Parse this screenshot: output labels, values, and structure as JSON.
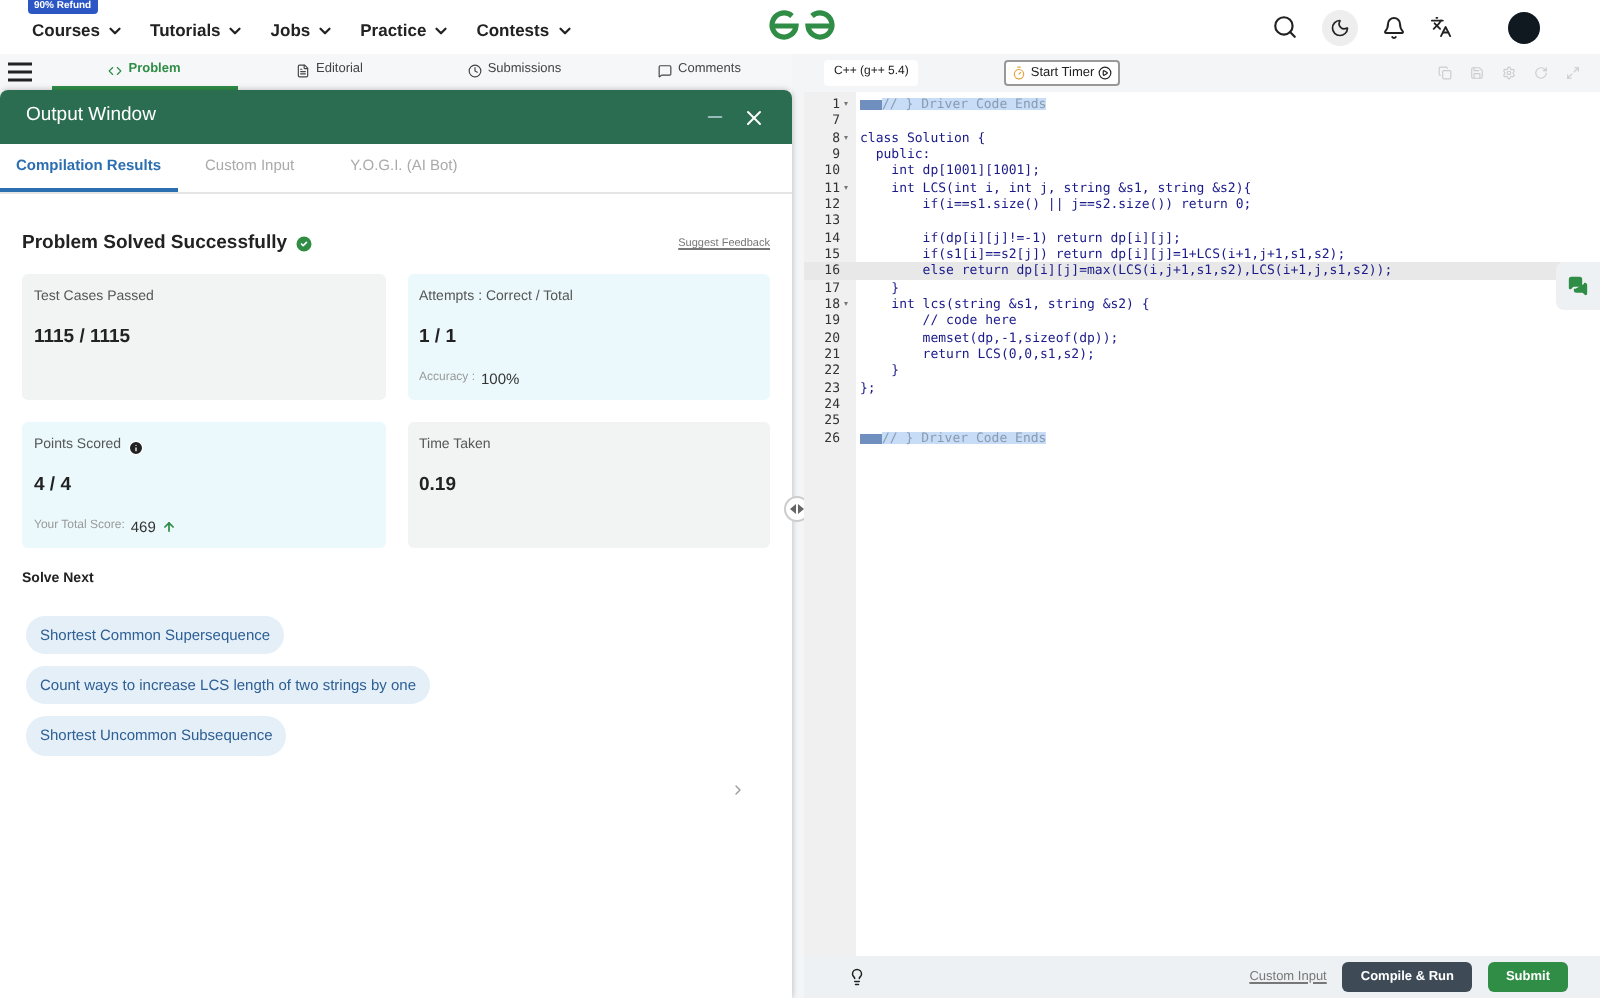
{
  "nav": {
    "badge": "90% Refund",
    "items": [
      "Courses",
      "Tutorials",
      "Jobs",
      "Practice",
      "Contests"
    ]
  },
  "problem_tabs": [
    {
      "label": "Problem",
      "selected": true
    },
    {
      "label": "Editorial",
      "selected": false
    },
    {
      "label": "Submissions",
      "selected": false
    },
    {
      "label": "Comments",
      "selected": false
    }
  ],
  "output_window": {
    "title": "Output Window",
    "tabs": [
      {
        "label": "Compilation Results",
        "selected": true
      },
      {
        "label": "Custom Input",
        "selected": false
      },
      {
        "label": "Y.O.G.I. (AI Bot)",
        "selected": false
      }
    ],
    "status": "Problem Solved Successfully",
    "feedback_link": "Suggest Feedback",
    "cards": [
      {
        "label": "Test Cases Passed",
        "value": "1115 / 1115",
        "info": false
      },
      {
        "label": "Attempts : Correct / Total",
        "value": "1 / 1",
        "info": false,
        "sub_label": "Accuracy :",
        "sub_value": "100%",
        "trend_up": false
      },
      {
        "label": "Points Scored",
        "value": "4 / 4",
        "info": true,
        "sub_label": "Your Total Score:",
        "sub_value": "469",
        "trend_up": true
      },
      {
        "label": "Time Taken",
        "value": "0.19",
        "info": false
      }
    ],
    "solve_next_title": "Solve Next",
    "solve_next": [
      "Shortest Common Supersequence",
      "Count ways to increase LCS length of two strings by one",
      "Shortest Uncommon Subsequence"
    ]
  },
  "editor": {
    "language": "C++ (g++ 5.4)",
    "timer_button": "Start Timer",
    "lines": [
      {
        "number": "1",
        "text": "// } Driver Code Ends",
        "highlighted": true,
        "foldable": true,
        "current": false
      },
      {
        "number": "7",
        "highlighted": false,
        "foldable": false,
        "current": false
      },
      {
        "number": "8",
        "text": "class Solution {",
        "highlighted": false,
        "foldable": true,
        "current": false
      },
      {
        "number": "9",
        "text": "  public:",
        "highlighted": false,
        "foldable": false,
        "current": false
      },
      {
        "number": "10",
        "text": "    int dp[1001][1001];",
        "highlighted": false,
        "foldable": false,
        "current": false
      },
      {
        "number": "11",
        "text": "    int LCS(int i, int j, string &s1, string &s2){",
        "highlighted": false,
        "foldable": true,
        "current": false
      },
      {
        "number": "12",
        "text": "        if(i==s1.size() || j==s2.size()) return 0;",
        "highlighted": false,
        "foldable": false,
        "current": false
      },
      {
        "number": "13",
        "highlighted": false,
        "foldable": false,
        "current": false
      },
      {
        "number": "14",
        "text": "        if(dp[i][j]!=-1) return dp[i][j];",
        "highlighted": false,
        "foldable": false,
        "current": false
      },
      {
        "number": "15",
        "text": "        if(s1[i]==s2[j]) return dp[i][j]=1+LCS(i+1,j+1,s1,s2);",
        "highlighted": false,
        "foldable": false,
        "current": false
      },
      {
        "number": "16",
        "text": "        else return dp[i][j]=max(LCS(i,j+1,s1,s2),LCS(i+1,j,s1,s2));",
        "highlighted": false,
        "foldable": false,
        "current": true
      },
      {
        "number": "17",
        "text": "    }",
        "highlighted": false,
        "foldable": false,
        "current": false
      },
      {
        "number": "18",
        "text": "    int lcs(string &s1, string &s2) {",
        "highlighted": false,
        "foldable": true,
        "current": false
      },
      {
        "number": "19",
        "text": "        // code here",
        "highlighted": false,
        "foldable": false,
        "current": false
      },
      {
        "number": "20",
        "text": "        memset(dp,-1,sizeof(dp));",
        "highlighted": false,
        "foldable": false,
        "current": false
      },
      {
        "number": "21",
        "text": "        return LCS(0,0,s1,s2);",
        "highlighted": false,
        "foldable": false,
        "current": false
      },
      {
        "number": "22",
        "text": "    }",
        "highlighted": false,
        "foldable": false,
        "current": false
      },
      {
        "number": "23",
        "text": "};",
        "highlighted": false,
        "foldable": false,
        "current": false
      },
      {
        "number": "24",
        "highlighted": false,
        "foldable": false,
        "current": false
      },
      {
        "number": "25",
        "highlighted": false,
        "foldable": false,
        "current": false
      },
      {
        "number": "26",
        "text": "// } Driver Code Ends",
        "highlighted": true,
        "foldable": false,
        "current": false
      }
    ],
    "footer": {
      "custom_input": "Custom Input",
      "compile_button": "Compile & Run",
      "submit_button": "Submit"
    }
  }
}
